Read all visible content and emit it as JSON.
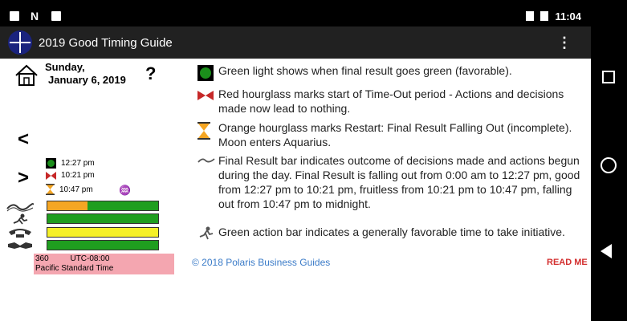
{
  "status": {
    "time": "11:04"
  },
  "appbar": {
    "title": "2019 Good Timing Guide",
    "overflow_icon": "more-vert-icon"
  },
  "date": {
    "line1": "Sunday,",
    "line2": "January 6, 2019"
  },
  "help": "?",
  "nav": {
    "prev": "<",
    "next": ">"
  },
  "legend": {
    "green_time": "12:27 pm",
    "red_time": "10:21 pm",
    "orange_time": "10:47 pm"
  },
  "bars": {
    "final_result": {
      "orange_fraction": 0.36,
      "colors": [
        "#f5a623",
        "#1f9e1f"
      ]
    },
    "action": {
      "color": "#1f9e1f"
    },
    "communication": {
      "color": "#f5f028"
    },
    "negotiation": {
      "color": "#1f9e1f"
    }
  },
  "timezone": {
    "offset": "360",
    "utc": "UTC-08:00",
    "name": "Pacific Standard Time"
  },
  "explanations": [
    {
      "icon": "green-light-icon",
      "text": "Green light shows when final result goes green (favorable)."
    },
    {
      "icon": "red-hourglass-icon",
      "text": "Red hourglass marks start of Time-Out period - Actions and decisions made now lead to nothing."
    },
    {
      "icon": "orange-hourglass-icon",
      "text": "Orange hourglass marks Restart: Final Result Falling Out (incomplete). Moon enters Aquarius."
    },
    {
      "icon": "final-result-icon",
      "text": "Final Result bar indicates outcome of decisions made and actions begun during the day. Final Result is falling out from 0:00 am to 12:27 pm, good from 12:27 pm to 10:21 pm, fruitless from 10:21 pm to 10:47 pm, falling out from 10:47 pm to midnight."
    },
    {
      "icon": "action-runner-icon",
      "text": "Green action bar indicates a generally favorable time to take initiative."
    }
  ],
  "footer": {
    "copyright": "© 2018 Polaris Business Guides",
    "readme": "READ ME"
  },
  "colors": {
    "appbar": "#212121",
    "green": "#1f9e1f",
    "orange": "#f5a623",
    "yellow": "#f5f028",
    "pink": "#f4a6b0",
    "link": "#3a7bc8",
    "readme": "#d32f2f"
  }
}
